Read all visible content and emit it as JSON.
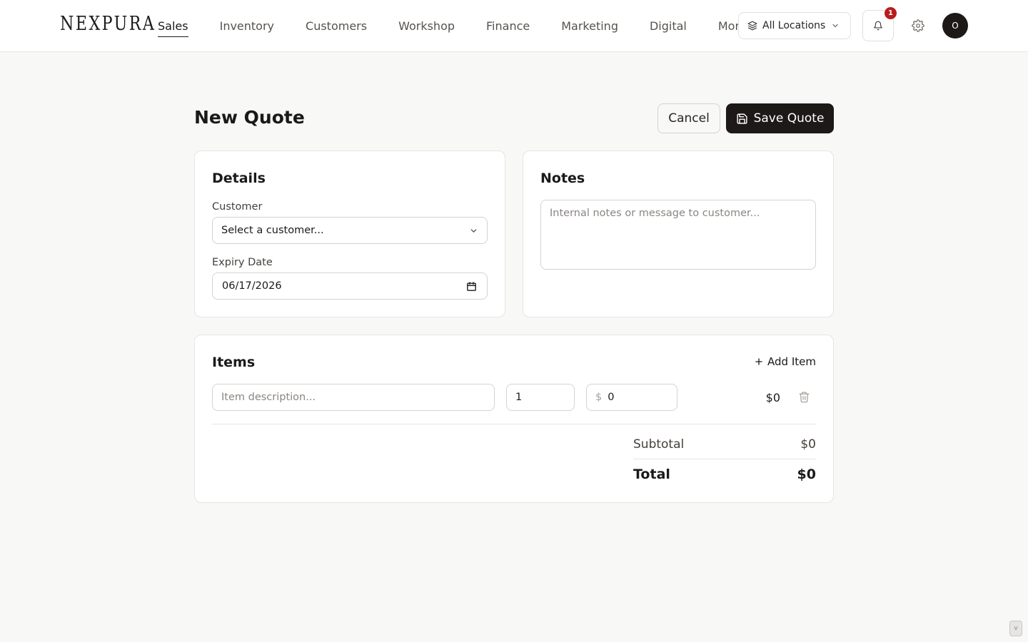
{
  "brand": {
    "logo_text": "NEXPURA"
  },
  "nav": {
    "items": [
      {
        "label": "Sales",
        "active": true
      },
      {
        "label": "Inventory",
        "active": false
      },
      {
        "label": "Customers",
        "active": false
      },
      {
        "label": "Workshop",
        "active": false
      },
      {
        "label": "Finance",
        "active": false
      },
      {
        "label": "Marketing",
        "active": false
      },
      {
        "label": "Digital",
        "active": false
      },
      {
        "label": "More",
        "active": false
      }
    ]
  },
  "header_actions": {
    "location_label": "All Locations",
    "location_icon": "layers-icon",
    "notification_count": "1",
    "notification_icon": "bell-icon",
    "settings_icon": "gear-icon",
    "avatar_initial": "O"
  },
  "page": {
    "title": "New Quote",
    "cancel_label": "Cancel",
    "save_label": "Save Quote"
  },
  "details": {
    "title": "Details",
    "customer_label": "Customer",
    "customer_value": "Select a customer...",
    "expiry_label": "Expiry Date",
    "expiry_value": "06/17/2026"
  },
  "notes": {
    "title": "Notes",
    "placeholder": "Internal notes or message to customer..."
  },
  "items": {
    "title": "Items",
    "add_label": "Add Item",
    "rows": [
      {
        "description_placeholder": "Item description...",
        "quantity": "1",
        "currency_symbol": "$",
        "price": "0",
        "line_total": "$0"
      }
    ],
    "subtotal_label": "Subtotal",
    "subtotal_value": "$0",
    "total_label": "Total",
    "total_value": "$0"
  },
  "corner": {
    "label": "v"
  },
  "colors": {
    "accent_dark": "#1c1917",
    "badge_red": "#b91c1c",
    "page_bg": "#f8f8f7"
  }
}
